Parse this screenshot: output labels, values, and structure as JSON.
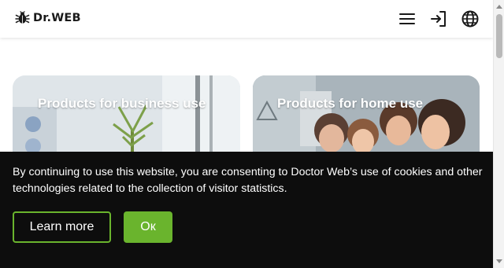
{
  "header": {
    "logo_text": "Dr.WEB",
    "icons": [
      "bug-logo-icon",
      "hamburger-menu-icon",
      "login-icon",
      "globe-icon"
    ]
  },
  "cards": [
    {
      "title": "Products for business use"
    },
    {
      "title": "Products for home use"
    }
  ],
  "cookie_banner": {
    "message": "By continuing to use this website, you are consenting to Doctor Web’s use of cookies and other technologies related to the collection of visitor statistics.",
    "learn_more_label": "Learn more",
    "ok_label": "Ок"
  },
  "colors": {
    "accent_green": "#6ab42d",
    "banner_background": "#0d0d0d",
    "text_dark": "#1a1a1a"
  }
}
